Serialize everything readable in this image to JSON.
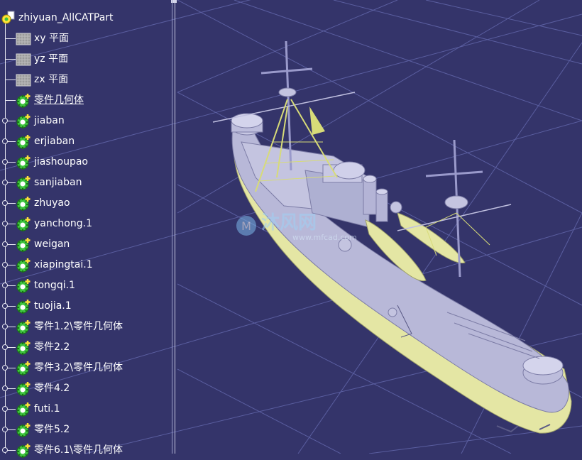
{
  "tree": {
    "root": {
      "label": "zhiyuan_AllCATPart",
      "icon": "part-gear-icon"
    },
    "items": [
      {
        "label": "xy 平面",
        "icon": "plane-icon",
        "expandable": false
      },
      {
        "label": "yz 平面",
        "icon": "plane-icon",
        "expandable": false
      },
      {
        "label": "zx 平面",
        "icon": "plane-icon",
        "expandable": false
      },
      {
        "label": "零件几何体",
        "icon": "body-gear-icon",
        "expandable": false,
        "underlined": true
      },
      {
        "label": "jiaban",
        "icon": "body-gear-icon",
        "expandable": true
      },
      {
        "label": "erjiaban",
        "icon": "body-gear-icon",
        "expandable": true
      },
      {
        "label": "jiashoupao",
        "icon": "body-gear-icon",
        "expandable": true
      },
      {
        "label": "sanjiaban",
        "icon": "body-gear-icon",
        "expandable": true
      },
      {
        "label": "zhuyao",
        "icon": "body-gear-icon",
        "expandable": true
      },
      {
        "label": "yanchong.1",
        "icon": "body-gear-icon",
        "expandable": true
      },
      {
        "label": "weigan",
        "icon": "body-gear-icon",
        "expandable": true
      },
      {
        "label": "xiapingtai.1",
        "icon": "body-gear-icon",
        "expandable": true
      },
      {
        "label": "tongqi.1",
        "icon": "body-gear-icon",
        "expandable": true
      },
      {
        "label": "tuojia.1",
        "icon": "body-gear-icon",
        "expandable": true
      },
      {
        "label": "零件1.2\\零件几何体",
        "icon": "body-gear-icon",
        "expandable": true
      },
      {
        "label": "零件2.2",
        "icon": "body-gear-icon",
        "expandable": true
      },
      {
        "label": "零件3.2\\零件几何体",
        "icon": "body-gear-icon",
        "expandable": true
      },
      {
        "label": "零件4.2",
        "icon": "body-gear-icon",
        "expandable": true
      },
      {
        "label": "futi.1",
        "icon": "body-gear-icon",
        "expandable": true
      },
      {
        "label": "零件5.2",
        "icon": "body-gear-icon",
        "expandable": true
      },
      {
        "label": "零件6.1\\零件几何体",
        "icon": "body-gear-icon",
        "expandable": true
      }
    ]
  },
  "viewport": {
    "model": "battleship-3d-model",
    "watermark": {
      "logo": "沐风网",
      "url": "www.mfcad.com"
    }
  },
  "colors": {
    "background": "#34346a",
    "grid": "#6f73b0",
    "hull_superstructure": "#b8b8d8",
    "hull_lower": "#e4e6a4",
    "rigging": "#d7db78",
    "tree_text": "#ffffff",
    "icon_green": "#3ec43e",
    "icon_yellow": "#ffe23a"
  }
}
